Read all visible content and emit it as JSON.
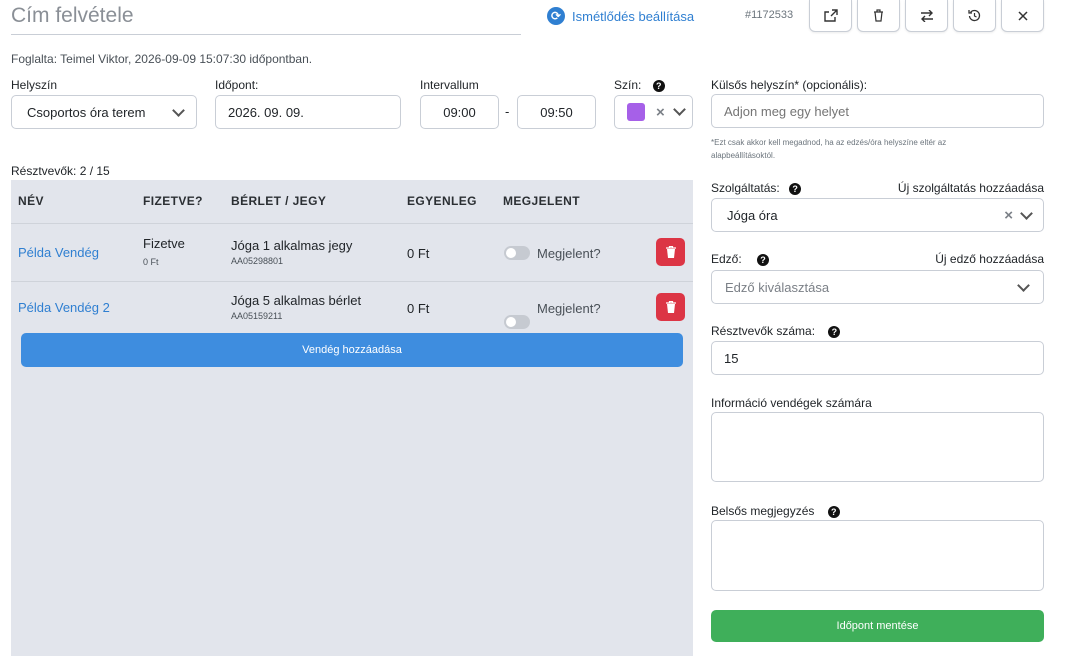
{
  "header": {
    "title_placeholder": "Cím felvétele",
    "repeat_label": "Ismétlődés beállítása",
    "booking_id": "#1172533"
  },
  "booked_by": "Foglalta: Teimel Viktor, 2026-09-09 15:07:30 időpontban.",
  "form": {
    "location_label": "Helyszín",
    "location_value": "Csoportos óra terem",
    "date_label": "Időpont:",
    "date_value": "2026. 09. 09.",
    "interval_label": "Intervallum",
    "start_time": "09:00",
    "separator": "-",
    "end_time": "09:50",
    "color_label": "Szín:",
    "color_value": "#a660e8",
    "external_location_label": "Külsős helyszín* (opcionális):",
    "external_location_placeholder": "Adjon meg egy helyet",
    "external_hint": "*Ezt csak akkor kell megadnod, ha az edzés/óra helyszíne eltér az alapbeállításoktól.",
    "service_label": "Szolgáltatás:",
    "service_add_link": "Új szolgáltatás hozzáadása",
    "service_value": "Jóga óra",
    "trainer_label": "Edző:",
    "trainer_add_link": "Új edző hozzáadása",
    "trainer_placeholder": "Edző kiválasztása",
    "participants_label": "Résztvevők száma:",
    "participants_value": "15",
    "guest_info_label": "Információ vendégek számára",
    "internal_note_label": "Belsős megjegyzés",
    "save_label": "Időpont mentése"
  },
  "participants": {
    "count_label": "Résztvevők: 2 / 15",
    "columns": [
      "NÉV",
      "FIZETVE?",
      "BÉRLET / JEGY",
      "EGYENLEG",
      "MEGJELENT"
    ],
    "rows": [
      {
        "name": "Példa Vendég",
        "paid": "Fizetve",
        "paid_amount": "0 Ft",
        "pass": "Jóga 1 alkalmas jegy",
        "pass_code": "AA05298801",
        "balance": "0 Ft",
        "attended_label": "Megjelent?"
      },
      {
        "name": "Példa Vendég 2",
        "paid": "",
        "paid_amount": "",
        "pass": "Jóga 5 alkalmas bérlet",
        "pass_code": "AA05159211",
        "balance": "0 Ft",
        "attended_label": "Megjelent?"
      }
    ],
    "add_guest_label": "Vendég hozzáadása"
  },
  "icons": [
    "repeat-icon",
    "share-icon",
    "trash-icon",
    "swap-icon",
    "history-icon",
    "close-icon",
    "chevron-down-icon",
    "help-icon",
    "clear-icon"
  ]
}
